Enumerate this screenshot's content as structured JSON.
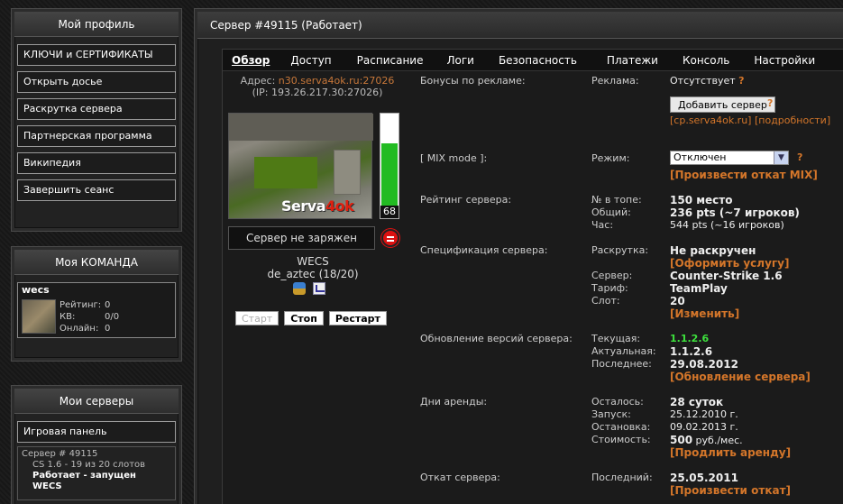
{
  "sidebar": {
    "profile": {
      "title": "Мой профиль",
      "items": [
        {
          "label": "КЛЮЧИ и СЕРТИФИКАТЫ"
        },
        {
          "label": "Открыть досье"
        },
        {
          "label": "Раскрутка сервера"
        },
        {
          "label": "Партнерская программа"
        },
        {
          "label": "Википедия"
        },
        {
          "label": "Завершить сеанс"
        }
      ]
    },
    "team": {
      "title": "Моя КОМАНДА",
      "member": "wecs",
      "rating_label": "Рейтинг:",
      "rating": "0",
      "kd_label": "КВ:",
      "kd": "0/0",
      "online_label": "Онлайн:",
      "online": "0"
    },
    "servers": {
      "title": "Мои серверы",
      "panel_button": "Игровая панель",
      "line1": "Сервер # 49115",
      "line2": "CS 1.6 - 19 из 20 слотов",
      "line3": "Работает - запущен",
      "line4": "WECS"
    }
  },
  "main": {
    "title": "Сервер #49115 (Работает)",
    "tabs": [
      "Обзор",
      "Доступ",
      "Расписание",
      "Логи",
      "Безопасность",
      "Платежи",
      "Консоль",
      "Настройки"
    ],
    "address_label": "Адрес:",
    "address": "n30.serva4ok.ru:27026",
    "ip": "(IP: 193.26.217.30:27026)",
    "thumb_logo_a": "Serva",
    "thumb_logo_b": "4ok",
    "load": 68,
    "load_text": "68",
    "charge_status": "Сервер не заряжен",
    "server_name": "WECS",
    "map_info": "de_aztec (18/20)",
    "btn_start": "Старт",
    "btn_stop": "Стоп",
    "btn_restart": "Рестарт"
  },
  "details": {
    "ads": {
      "section": "Бонусы по рекламе:",
      "k": "Реклама:",
      "v": "Отсутствует",
      "q": "?",
      "button": "Добавить сервер",
      "link1": "[cp.serva4ok.ru]",
      "link2": "[подробности]"
    },
    "mix": {
      "section": "[ MIX mode ]:",
      "k": "Режим:",
      "select": "Отключен",
      "q": "?",
      "link": "[Произвести откат MIX]"
    },
    "rating": {
      "section": "Рейтинг сервера:",
      "k1": "№ в топе:",
      "v1": "150 место",
      "k2": "Общий:",
      "v2": "236 pts (~7 игроков)",
      "k3": "Час:",
      "v3": "544 pts (~16 игроков)"
    },
    "spec": {
      "section": "Спецификация сервера:",
      "k1": "Раскрутка:",
      "v1": "Не раскручен",
      "link1": "[Оформить услугу]",
      "k2": "Сервер:",
      "v2": "Counter-Strike 1.6",
      "k3": "Тариф:",
      "v3": "TeamPlay",
      "k4": "Слот:",
      "v4": "20",
      "link2": "[Изменить]"
    },
    "version": {
      "section": "Обновление версий сервера:",
      "k1": "Текущая:",
      "v1": "1.1.2.6",
      "k2": "Актуальная:",
      "v2": "1.1.2.6",
      "k3": "Последнее:",
      "v3": "29.08.2012",
      "link": "[Обновление сервера]"
    },
    "rent": {
      "section": "Дни аренды:",
      "k1": "Осталось:",
      "v1": "28 суток",
      "k2": "Запуск:",
      "v2": "25.12.2010 г.",
      "k3": "Остановка:",
      "v3": "09.02.2013 г.",
      "k4": "Стоимость:",
      "v4a": "500",
      "v4b": " руб./мес.",
      "link": "[Продлить аренду]"
    },
    "rollback": {
      "section": "Откат сервера:",
      "k1": "Последний:",
      "v1": "25.05.2011",
      "link": "[Произвести откат]"
    }
  },
  "colors": {
    "accent": "#d4762a",
    "green": "#3de23d",
    "load_bar": "#22bb22"
  }
}
